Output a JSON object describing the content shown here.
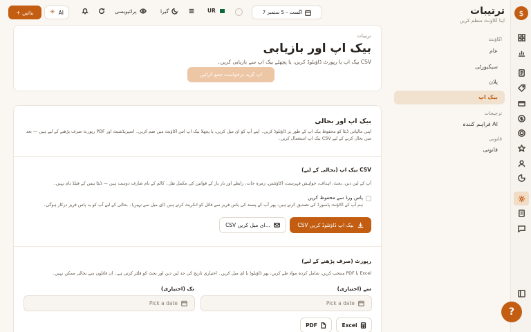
{
  "sidebar": {
    "title": "ترتیبات",
    "subtitle": "اپنا اکاؤنٹ منظم کریں",
    "groups": [
      {
        "label": "اکاؤنٹ",
        "items": [
          {
            "label": "عام"
          },
          {
            "label": "سیکیورٹی"
          },
          {
            "label": "پلان"
          },
          {
            "label": "بیک اپ",
            "active": true
          }
        ]
      },
      {
        "label": "ترجیحات",
        "items": [
          {
            "label": "AI فراہم کنندہ"
          }
        ]
      },
      {
        "label": "قانونی",
        "items": [
          {
            "label": "قانونی"
          }
        ]
      }
    ]
  },
  "topbar": {
    "new_label": "+ بنائیں",
    "ai_label": "AI",
    "privacy_label": "پرائیویسی",
    "theme_label": "گیرا",
    "lang_label": "UR",
    "date_range": "7 اگست – 5 ستمبر"
  },
  "page": {
    "breadcrumb": "ترتیبات",
    "title": "بیک اپ اور بازیابی",
    "subtitle": "CSV بیک اپ یا رپورٹ ڈاؤنلوڈ کریں، یا پچھلے بیک اپ سے بازیابی کریں۔",
    "faded_button": "اپ گرید درخواست جمع کرائیں"
  },
  "backup": {
    "title": "بیک اپ اور بحالی",
    "desc": "اپنی مالیاتی ڈیٹا کو محفوظ بیک اپ کے طور پر ڈاؤنلوڈ کریں۔ اپنے آپ کو ای میل کریں، یا پچھلا بیک اپ اس اکاؤنٹ میں ضم کریں۔ اسپریڈشیٹ اور PDF رپورٹ صرف پڑھنے کے لیے ہیں — بعد میں بحال کرنے کے لیے CSV بیک اپ استعمال کریں۔",
    "csv_title": "CSV بیک اپ (بحالی کے لیے)",
    "csv_desc": "آپ کے لین دین، بجٹ، اہداف، خواہش فہرست، اکاؤنٹس، زمرہ جات، رابطے اور بار بار کے قوانین کی مکمل نقل۔ کالم کے نام صارف دوست ہیں — ڈیٹا بیس کے فیلڈ نام نہیں۔",
    "password_label": "پاس ورڈ سے محفوظ کریں",
    "password_desc": "ہم آپ کے اکاؤنٹ پاسورڈ کی تصدیق کرتے ہیں، پھر آپ کے پسند کی پاس فریز سے فائل کو انکرپٹ کرتے ہیں (ای میل سے نہیں)۔ بحالی کے لیے آپ کو یہ پاس فریز درکار ہوگی۔",
    "download_label": "CSV بیک اپ ڈاؤنلوڈ کریں",
    "email_label": "CSV ای میل کریں..."
  },
  "report": {
    "title": "رپورٹ (صرف پڑھنے کے لیے)",
    "desc": "Excel یا PDF منتخب کریں، شامل کردہ مواد طے کریں، پھر ڈاؤنلوڈ یا ای میل کریں۔ اختیاری تاریخ کی حد لین دین اور بجٹ کو فلٹر کرتی ہے۔ ان فائلوں سے بحالی ممکن نہیں۔",
    "from_label": "سے (اختیاری)",
    "to_label": "تک (اختیاری)",
    "date_placeholder": "Pick a date",
    "excel_label": "Excel",
    "pdf_label": "PDF"
  },
  "help_label": "?"
}
